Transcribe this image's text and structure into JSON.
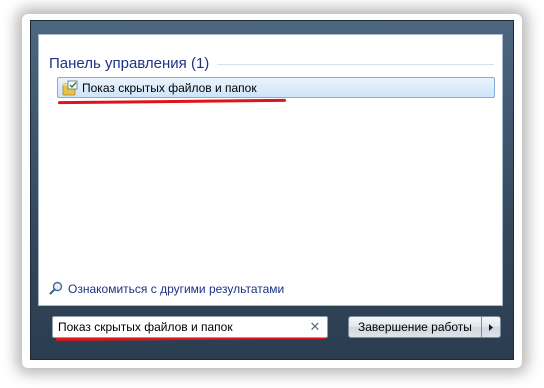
{
  "results": {
    "group_title": "Панель управления (1)",
    "items": [
      {
        "label": "Показ скрытых файлов и папок",
        "icon": "folder-options-icon"
      }
    ]
  },
  "see_more": {
    "label": "Ознакомиться с другими результатами",
    "icon": "search-icon"
  },
  "search": {
    "value": "Показ скрытых файлов и папок",
    "clear_icon": "✕"
  },
  "shutdown": {
    "label": "Завершение работы",
    "arrow_icon": "chevron-right-icon"
  },
  "colors": {
    "highlight": "#e0151b",
    "header_text": "#1e3287",
    "selection_border": "#84acdd"
  }
}
